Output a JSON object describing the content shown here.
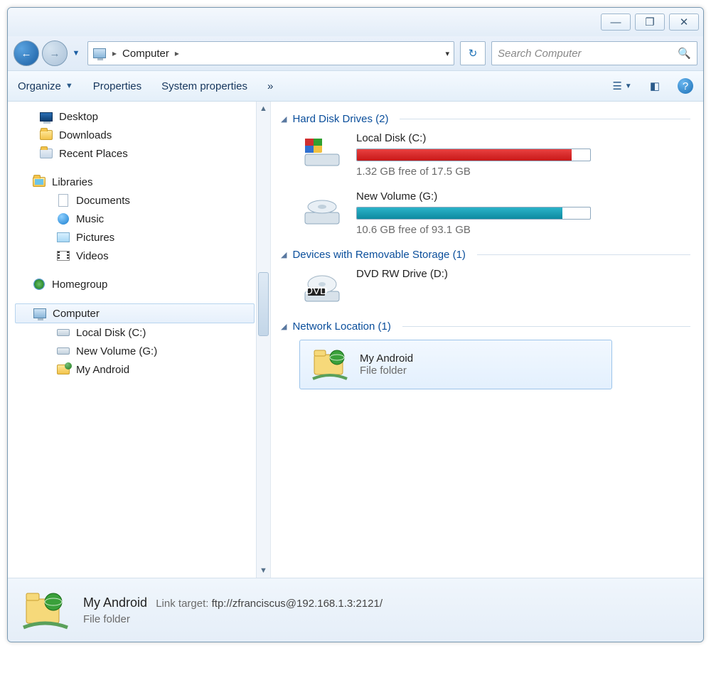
{
  "titlebar": {
    "min": "—",
    "max": "❐",
    "close": "✕"
  },
  "nav": {
    "crumb_root": "Computer",
    "search_placeholder": "Search Computer"
  },
  "toolbar": {
    "organize": "Organize",
    "properties": "Properties",
    "sysprops": "System properties",
    "more": "»"
  },
  "tree": {
    "desktop": "Desktop",
    "downloads": "Downloads",
    "recent": "Recent Places",
    "libraries": "Libraries",
    "documents": "Documents",
    "music": "Music",
    "pictures": "Pictures",
    "videos": "Videos",
    "homegroup": "Homegroup",
    "computer": "Computer",
    "localdisk": "Local Disk (C:)",
    "newvol": "New Volume (G:)",
    "myandroid": "My Android"
  },
  "groups": {
    "hdd": "Hard Disk Drives (2)",
    "removable": "Devices with Removable Storage (1)",
    "network": "Network Location (1)"
  },
  "drives": {
    "c": {
      "name": "Local Disk (C:)",
      "stat": "1.32 GB free of 17.5 GB",
      "fillClass": "red"
    },
    "g": {
      "name": "New Volume (G:)",
      "stat": "10.6 GB free of 93.1 GB",
      "fillClass": "teal"
    },
    "dvd": {
      "name": "DVD RW Drive (D:)"
    }
  },
  "netloc": {
    "name": "My Android",
    "type": "File folder"
  },
  "details": {
    "name": "My Android",
    "linkLabel": "Link target:",
    "linkValue": "ftp://zfranciscus@192.168.1.3:2121/",
    "type": "File folder"
  }
}
